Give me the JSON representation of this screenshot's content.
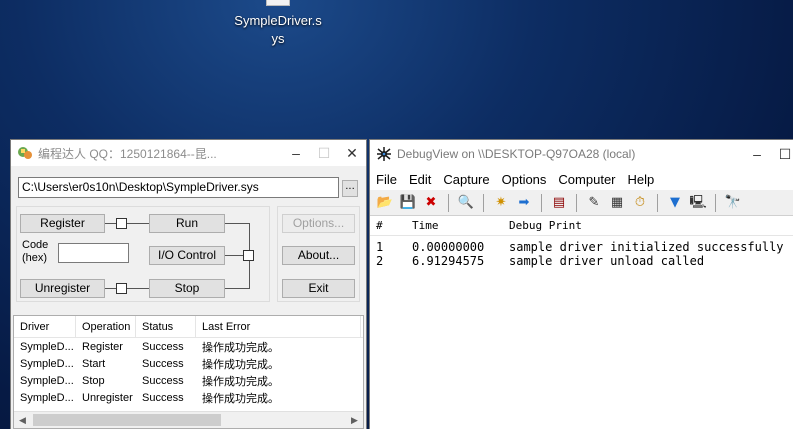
{
  "desktop": {
    "icon_label": "SympleDriver.sys"
  },
  "loader": {
    "title": "编程达人 QQ：1250121864--昆...",
    "path": "C:\\Users\\er0s10n\\Desktop\\SympleDriver.sys",
    "browse_label": "...",
    "buttons": {
      "register": "Register",
      "run": "Run",
      "io_control": "I/O Control",
      "unregister": "Unregister",
      "stop": "Stop",
      "options": "Options...",
      "about": "About...",
      "exit": "Exit"
    },
    "code_label": "Code (hex)",
    "code_value": "",
    "columns": [
      "Driver",
      "Operation",
      "Status",
      "Last Error"
    ],
    "rows": [
      [
        "SympleD...",
        "Register",
        "Success",
        "操作成功完成。"
      ],
      [
        "SympleD...",
        "Start",
        "Success",
        "操作成功完成。"
      ],
      [
        "SympleD...",
        "Stop",
        "Success",
        "操作成功完成。"
      ],
      [
        "SympleD...",
        "Unregister",
        "Success",
        "操作成功完成。"
      ]
    ]
  },
  "debugview": {
    "title": "DebugView on \\\\DESKTOP-Q97OA28 (local)",
    "menu": [
      "File",
      "Edit",
      "Capture",
      "Options",
      "Computer",
      "Help"
    ],
    "toolbar_icons": [
      "open-icon",
      "save-icon",
      "clear-icon",
      "find-icon",
      "capture-icon",
      "autoscroll-icon",
      "history-icon",
      "filter-icon",
      "highlight-icon",
      "time-icon",
      "options-icon",
      "computer-icon",
      "connect-icon"
    ],
    "columns": [
      "#",
      "Time",
      "Debug Print"
    ],
    "rows": [
      [
        "1",
        "0.00000000",
        "sample driver initialized successfully"
      ],
      [
        "2",
        "6.91294575",
        "sample driver unload called"
      ]
    ]
  }
}
